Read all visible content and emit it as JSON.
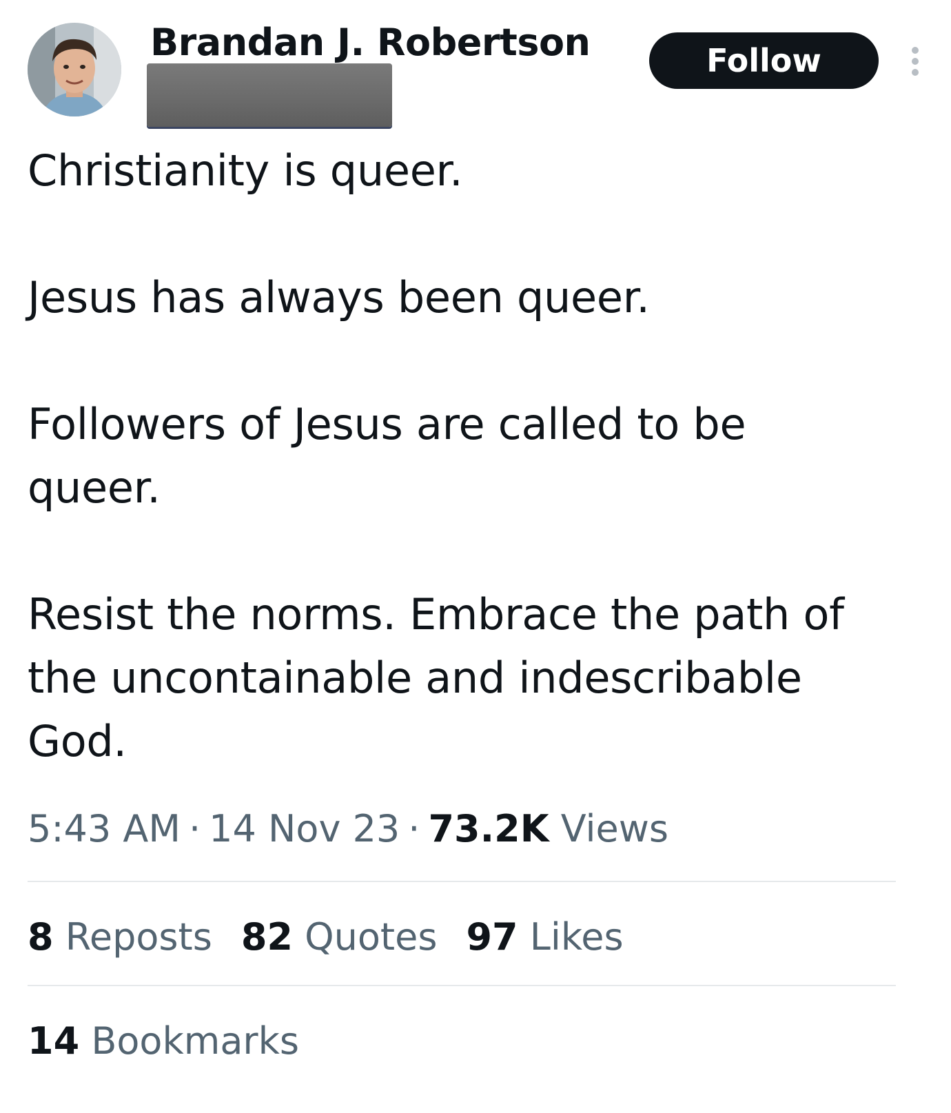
{
  "author": {
    "display_name": "Brandan J. Robertson",
    "avatar_icon": "profile-photo"
  },
  "follow_button": {
    "label": "Follow"
  },
  "more_icon": "more-vertical-icon",
  "tweet": {
    "paragraphs": [
      "Christianity is queer.",
      "Jesus has always been queer.",
      "Followers of Jesus are called to be queer.",
      "Resist the norms. Embrace the path of the uncontainable and indescribable God."
    ]
  },
  "meta": {
    "time": "5:43 AM",
    "separator": "·",
    "date": "14 Nov 23",
    "views_count": "73.2K",
    "views_label": "Views"
  },
  "stats": {
    "reposts_count": "8",
    "reposts_label": "Reposts",
    "quotes_count": "82",
    "quotes_label": "Quotes",
    "likes_count": "97",
    "likes_label": "Likes",
    "bookmarks_count": "14",
    "bookmarks_label": "Bookmarks"
  },
  "colors": {
    "text_primary": "#0f1419",
    "text_secondary": "#536471",
    "divider": "#e6e9eb",
    "button_bg": "#0f1419"
  }
}
